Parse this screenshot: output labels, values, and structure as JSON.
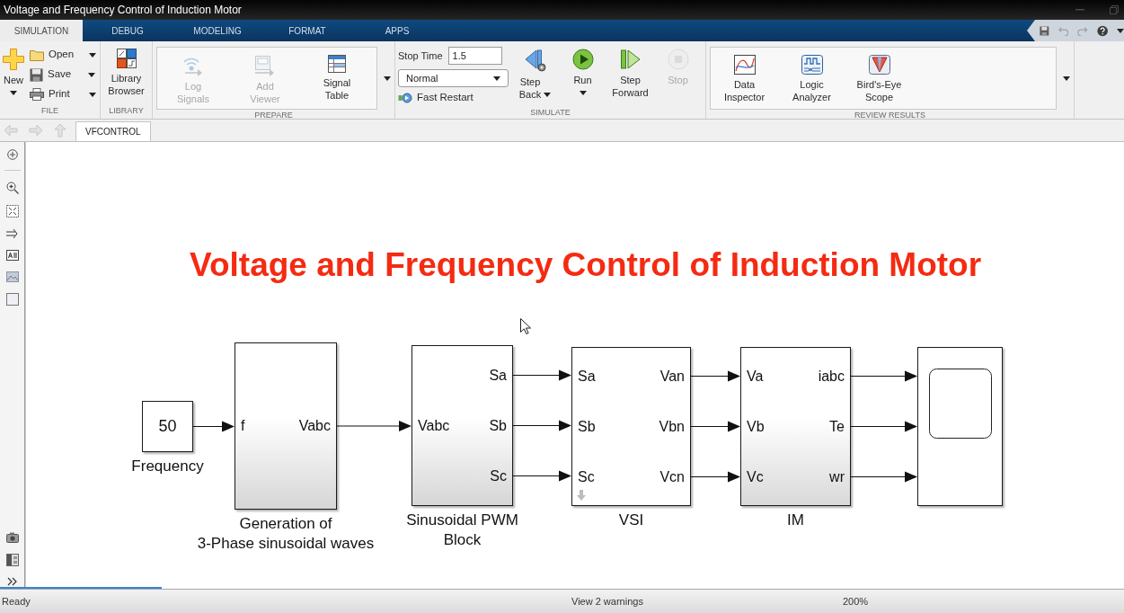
{
  "window": {
    "title": "Voltage and Frequency Control of Induction Motor"
  },
  "ribbon_tabs": [
    {
      "label": "SIMULATION",
      "selected": true
    },
    {
      "label": "DEBUG",
      "selected": false
    },
    {
      "label": "MODELING",
      "selected": false
    },
    {
      "label": "FORMAT",
      "selected": false
    },
    {
      "label": "APPS",
      "selected": false
    }
  ],
  "ribbon": {
    "sections": [
      {
        "title": "FILE",
        "items": [
          {
            "kind": "large",
            "label": "New",
            "caret": true,
            "disabled": false
          },
          {
            "kind": "small",
            "label": "Open",
            "caret": true,
            "disabled": false
          },
          {
            "kind": "small",
            "label": "Save",
            "caret": true,
            "disabled": false
          },
          {
            "kind": "small",
            "label": "Print",
            "caret": true,
            "disabled": false
          }
        ]
      },
      {
        "title": "LIBRARY",
        "items": [
          {
            "kind": "large",
            "label": "Library\nBrowser",
            "disabled": false
          }
        ]
      },
      {
        "title": "PREPARE",
        "gallery": true,
        "items": [
          {
            "kind": "large",
            "label": "Log\nSignals",
            "disabled": true
          },
          {
            "kind": "large",
            "label": "Add\nViewer",
            "disabled": true
          },
          {
            "kind": "large",
            "label": "Signal\nTable",
            "disabled": false
          }
        ]
      },
      {
        "title": "SIMULATE",
        "items": [
          {
            "kind": "field",
            "label": "Stop Time",
            "value": "1.5"
          },
          {
            "kind": "dropdown",
            "value": "Normal"
          },
          {
            "kind": "small",
            "label": "Fast Restart",
            "disabled": false
          },
          {
            "kind": "large",
            "label": "Step\nBack",
            "caret": true,
            "disabled": false
          },
          {
            "kind": "large",
            "label": "Run",
            "caret": true,
            "disabled": false
          },
          {
            "kind": "large",
            "label": "Step\nForward",
            "disabled": false
          },
          {
            "kind": "large",
            "label": "Stop",
            "disabled": true
          }
        ]
      },
      {
        "title": "REVIEW RESULTS",
        "gallery": true,
        "items": [
          {
            "kind": "large",
            "label": "Data\nInspector",
            "disabled": false
          },
          {
            "kind": "large",
            "label": "Logic\nAnalyzer",
            "disabled": false
          },
          {
            "kind": "large",
            "label": "Bird's-Eye\nScope",
            "disabled": false
          }
        ]
      }
    ]
  },
  "model_tabs": [
    {
      "label": "VFCONTROL",
      "selected": true
    }
  ],
  "diagram": {
    "title": "Voltage and Frequency Control of Induction Motor",
    "blocks": [
      {
        "kind": "constant",
        "value": "50",
        "label": "Frequency"
      },
      {
        "kind": "subsystem",
        "label": "Generation of\n3-Phase sinusoidal waves",
        "inputs": [
          "f"
        ],
        "outputs": [
          "Vabc"
        ]
      },
      {
        "kind": "subsystem",
        "label": "Sinusoidal PWM\nBlock",
        "inputs": [
          "Vabc"
        ],
        "outputs": [
          "Sa",
          "Sb",
          "Sc"
        ]
      },
      {
        "kind": "subsystem",
        "label": "VSI",
        "inputs": [
          "Sa",
          "Sb",
          "Sc"
        ],
        "outputs": [
          "Van",
          "Vbn",
          "Vcn"
        ]
      },
      {
        "kind": "subsystem",
        "label": "IM",
        "inputs": [
          "Va",
          "Vb",
          "Vc"
        ],
        "outputs": [
          "iabc",
          "Te",
          "wr"
        ]
      },
      {
        "kind": "scope"
      }
    ]
  },
  "status_bar": {
    "status": "Ready",
    "warnings": "View 2 warnings",
    "zoom": "200%"
  }
}
